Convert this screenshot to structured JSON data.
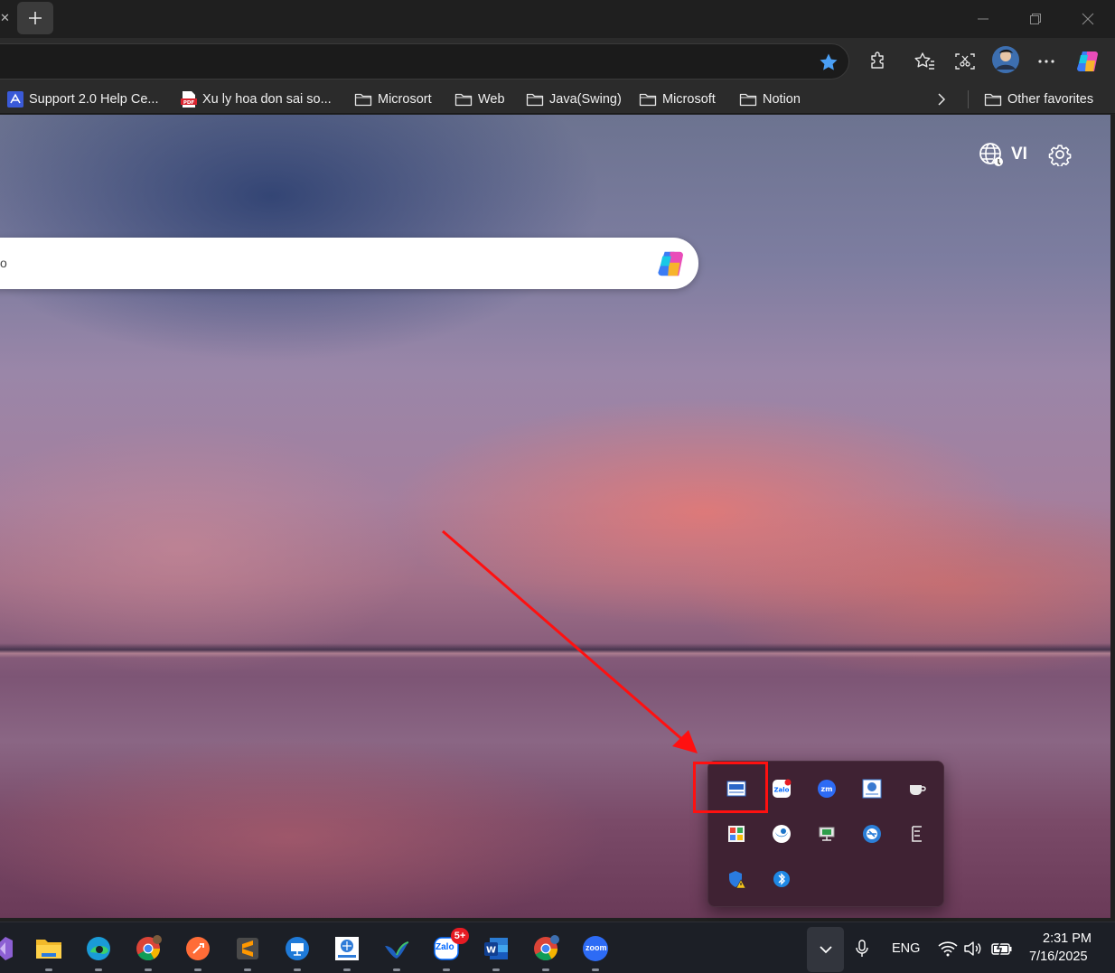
{
  "browser": {
    "bookmarks": [
      {
        "label": "Support 2.0 Help Ce...",
        "type": "site"
      },
      {
        "label": "Xu ly hoa don sai so...",
        "type": "pdf"
      },
      {
        "label": "Microsort",
        "type": "folder"
      },
      {
        "label": "Web",
        "type": "folder"
      },
      {
        "label": "Java(Swing)",
        "type": "folder"
      },
      {
        "label": "Microsoft",
        "type": "folder"
      },
      {
        "label": "Notion",
        "type": "folder"
      }
    ],
    "other_favorites": "Other favorites"
  },
  "newtab": {
    "language": "VI",
    "search_placeholder_fragment": "o"
  },
  "tray_overflow": {
    "icons": [
      "invoice-app-icon",
      "zalo-icon",
      "zoom-icon",
      "einvoice-icon",
      "teacup-icon",
      "photos-icon",
      "ultraviewer-icon",
      "network-monitor-icon",
      "teamviewer-icon",
      "epub-reader-icon",
      "security-warning-icon",
      "bluetooth-icon"
    ]
  },
  "taskbar": {
    "apps": [
      "visual-studio-icon",
      "file-explorer-icon",
      "edge-icon",
      "chrome-icon",
      "postman-icon",
      "sublime-text-icon",
      "remote-desktop-icon",
      "einvoice-icon",
      "bird-app-icon",
      "zalo-icon",
      "word-icon",
      "chrome-profile-icon",
      "zoom-icon"
    ],
    "zalo_badge": "5+",
    "zoom_label": "zoom",
    "zalo_label": "Zalo",
    "language": "ENG",
    "time": "2:31 PM",
    "date": "7/16/2025"
  },
  "colors": {
    "accent_red": "#ff1010",
    "taskbar": "#1c1f26",
    "flyout": "#3f2233"
  }
}
